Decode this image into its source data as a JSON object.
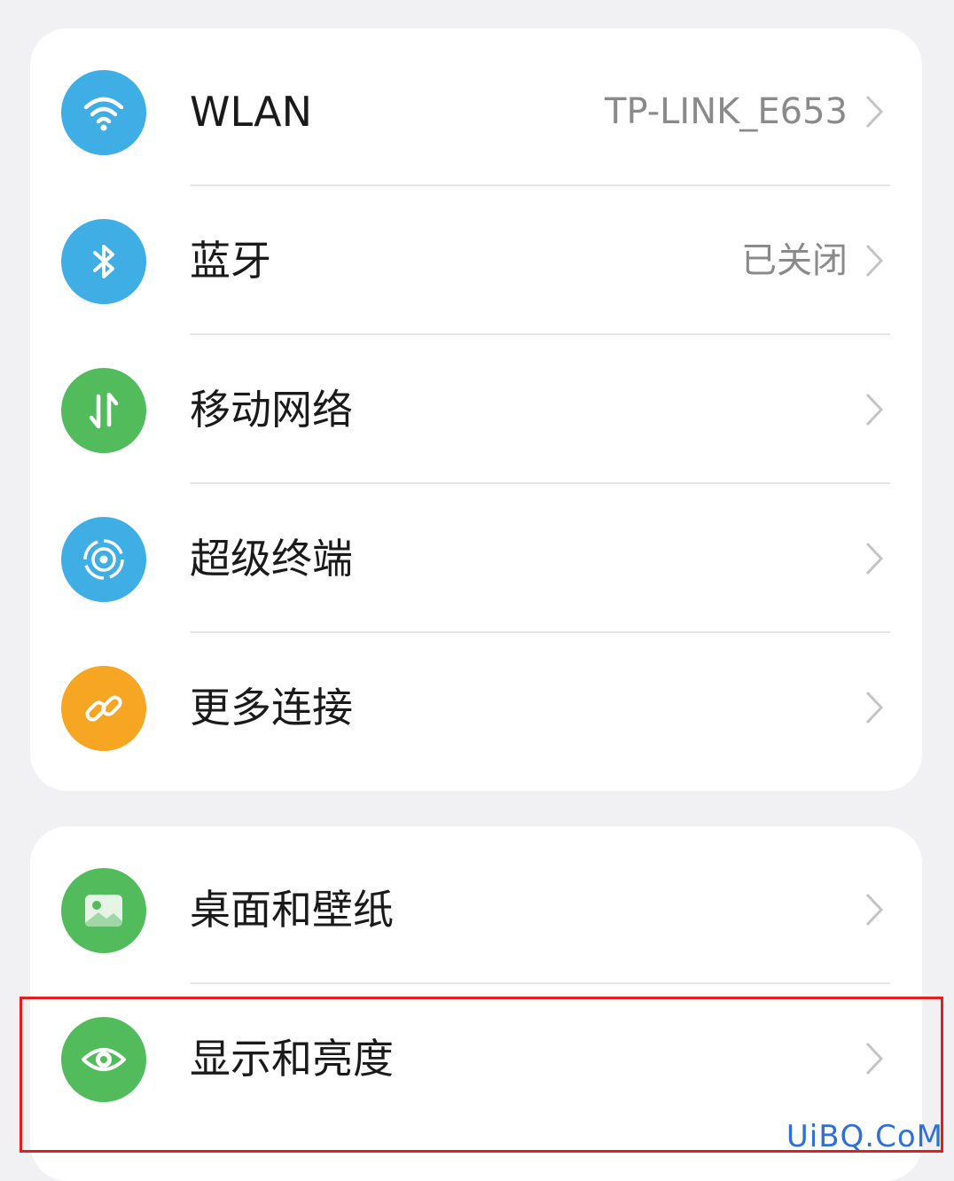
{
  "connectivity": {
    "items": [
      {
        "label": "WLAN",
        "value": "TP-LINK_E653",
        "icon": "wifi-icon",
        "color": "#3faee5"
      },
      {
        "label": "蓝牙",
        "value": "已关闭",
        "icon": "bluetooth-icon",
        "color": "#3faee5"
      },
      {
        "label": "移动网络",
        "value": "",
        "icon": "mobile-data-icon",
        "color": "#52bb5c"
      },
      {
        "label": "超级终端",
        "value": "",
        "icon": "super-device-icon",
        "color": "#3faee5"
      },
      {
        "label": "更多连接",
        "value": "",
        "icon": "link-icon",
        "color": "#f6a623"
      }
    ]
  },
  "display": {
    "items": [
      {
        "label": "桌面和壁纸",
        "value": "",
        "icon": "wallpaper-icon",
        "color": "#52bb5c"
      },
      {
        "label": "显示和亮度",
        "value": "",
        "icon": "eye-icon",
        "color": "#52bb5c"
      }
    ]
  },
  "watermark": "UiBQ.CoM",
  "highlight_color": "#e02020"
}
